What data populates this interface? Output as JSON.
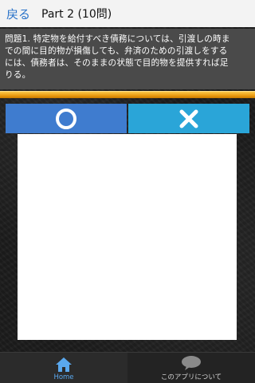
{
  "header": {
    "back_label": "戻る",
    "title": "Part 2 (10問)"
  },
  "question": {
    "text": "問題1. 特定物を給付すべき債務については、引渡しの時までの間に目的物が損傷しても、弁済のための引渡しをするには、債務者は、そのままの状態で目的物を提供すれば足りる。"
  },
  "progress": {
    "fraction": 1.0,
    "color": "#f2a81c"
  },
  "answers": {
    "correct_icon": "circle-icon",
    "correct_color": "#3f7ccf",
    "wrong_icon": "cross-icon",
    "wrong_color": "#2aa5d8"
  },
  "bottom_nav": {
    "items": [
      {
        "label": "Home",
        "icon": "home-icon",
        "active": true
      },
      {
        "label": "このアプリについて",
        "icon": "speech-bubble-icon",
        "active": false
      }
    ]
  },
  "colors": {
    "accent": "#5aa8ee",
    "back_link": "#2a73c9"
  }
}
